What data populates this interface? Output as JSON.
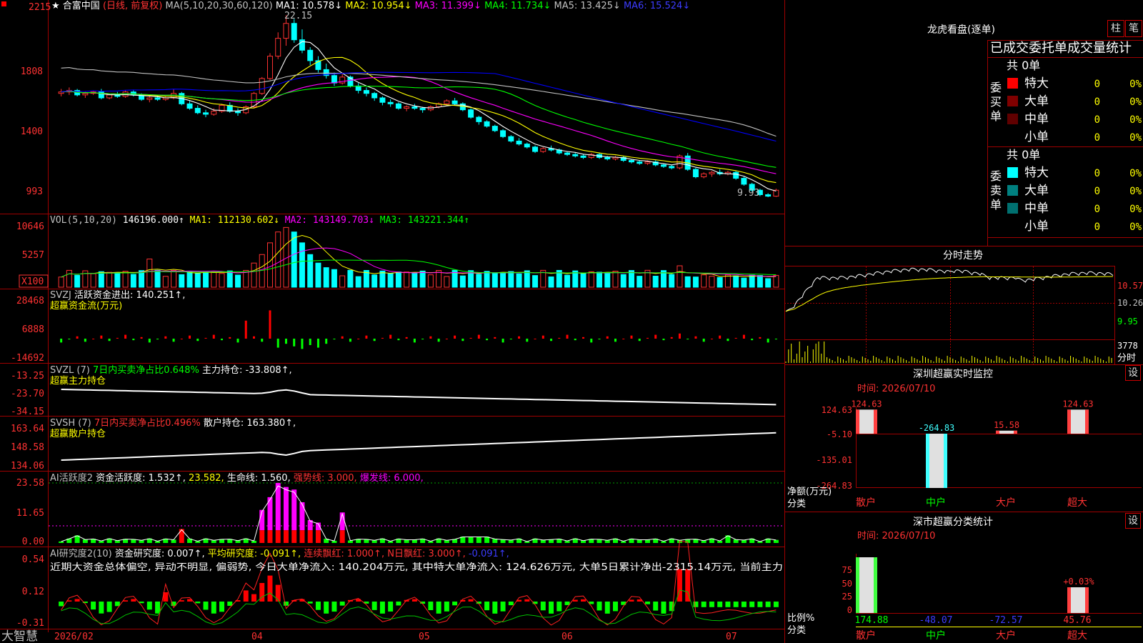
{
  "colors": {
    "up": "#ff3232",
    "down": "#00ffff",
    "ma1": "#ffffff",
    "ma2": "#ffff00",
    "ma3": "#ff00ff",
    "ma4": "#00ff00",
    "ma5": "#c0c0c0",
    "ma6": "#0000ff",
    "pos": "#ff0000",
    "neg": "#00ff00",
    "grid": "#a00000"
  },
  "header": {
    "marker": "★",
    "stock_name": "合富中国",
    "mode": "(日线, 前复权)",
    "ma_def": "MA(5,10,20,30,60,120)",
    "ma_items": [
      {
        "label": "MA1: 10.578↓",
        "color": "#ffffff"
      },
      {
        "label": "MA2: 10.954↓",
        "color": "#ffff00"
      },
      {
        "label": "MA3: 11.399↓",
        "color": "#ff00ff"
      },
      {
        "label": "MA4: 11.734↓",
        "color": "#00ff00"
      },
      {
        "label": "MA5: 13.425↓",
        "color": "#c0c0c0"
      },
      {
        "label": "MA6: 15.524↓",
        "color": "#3c3cff"
      }
    ]
  },
  "price_axis": [
    "2215",
    "1808",
    "1400",
    "993"
  ],
  "price_marks": {
    "high": "22.15",
    "low": "9.93"
  },
  "vol_panel": {
    "label": "VOL(5,10,20)",
    "value": "146196.000↑",
    "items": [
      {
        "label": "MA1: 112130.602↓",
        "color": "#ffff00"
      },
      {
        "label": "MA2: 143149.703↓",
        "color": "#ff00ff"
      },
      {
        "label": "MA3: 143221.344↑",
        "color": "#00ff00"
      }
    ],
    "axis": [
      "10646",
      "5257"
    ],
    "unit": "X100"
  },
  "svzj": {
    "label": "SVZJ",
    "desc": "活跃资金进出: 140.251↑,",
    "subtitle": "超赢资金流(万元)",
    "axis": [
      "28468",
      "6888",
      "-14692"
    ]
  },
  "svzl": {
    "label": "SVZL (7)",
    "desc1": "7日内买卖净占比0.648%",
    "desc2": "主力持仓: -33.808↑,",
    "subtitle": "超赢主力持仓",
    "axis": [
      "-13.25",
      "-23.70",
      "-34.15"
    ]
  },
  "svsh": {
    "label": "SVSH (7)",
    "desc1": "7日内买卖净占比0.496%",
    "desc2": "散户持仓: 163.380↑,",
    "subtitle": "超赢散户持仓",
    "axis": [
      "163.64",
      "148.58",
      "134.06"
    ]
  },
  "ai_act": {
    "label": "AI活跃度2",
    "desc": "资金活跃度: 1.532↑,",
    "v2": "23.582,",
    "life": "生命线: 1.560,",
    "strong": "强势线: 3.000,",
    "burst": "爆发线: 6.000,",
    "axis": [
      "23.58",
      "11.65",
      "0.00"
    ]
  },
  "ai_res": {
    "label": "AI研究度2(10)",
    "desc": "资金研究度: 0.007↑,",
    "avg": "平均研究度: -0.091↑,",
    "cont": "连续飘红: 1.000↑,",
    "n": "N日飘红: 3.000↑,",
    "last": "-0.091↑,",
    "note": "近期大资金总体偏空, 异动不明显, 偏弱势, 今日大单净流入: 140.204万元, 其中特大单净流入: 124.626万元, 大单5日累计净出-2315.14万元, 当前主力",
    "axis": [
      "0.54",
      "0.12",
      "-0.31"
    ]
  },
  "date_axis": {
    "start": "2026/02",
    "ticks": [
      "04",
      "05",
      "06",
      "07"
    ]
  },
  "brand": "大智慧",
  "dragon": {
    "title": "龙虎看盘(逐单)",
    "btn1": "柱",
    "btn2": "笔",
    "header": "已成交委托单成交量统计",
    "buy": {
      "side": "委买单",
      "total": "共 0单",
      "rows": [
        {
          "name": "特大",
          "v": "0",
          "p": "0%",
          "color": "#ff0000"
        },
        {
          "name": "大单",
          "v": "0",
          "p": "0%",
          "color": "#800000"
        },
        {
          "name": "中单",
          "v": "0",
          "p": "0%",
          "color": "#600000"
        },
        {
          "name": "小单",
          "v": "0",
          "p": "0%",
          "color": ""
        }
      ]
    },
    "sell": {
      "side": "委卖单",
      "total": "共 0单",
      "rows": [
        {
          "name": "特大",
          "v": "0",
          "p": "0%",
          "color": "#00ffff"
        },
        {
          "name": "大单",
          "v": "0",
          "p": "0%",
          "color": "#008080"
        },
        {
          "name": "中单",
          "v": "0",
          "p": "0%",
          "color": "#007070"
        },
        {
          "name": "小单",
          "v": "0",
          "p": "0%",
          "color": ""
        }
      ]
    }
  },
  "intraday": {
    "title": "分时走势",
    "axis": [
      "10.57",
      "10.26",
      "9.95"
    ],
    "vol_label": "3778",
    "vol_unit": "分时"
  },
  "monitor": {
    "title": "深圳超赢实时监控",
    "btn": "设",
    "date": "时间: 2026/07/10",
    "axis": [
      "124.63",
      "-5.10",
      "-135.01",
      "-264.83"
    ],
    "ylabel1": "净额(万元)",
    "ylabel2": "分类",
    "bars": [
      {
        "cat": "散户",
        "label": "124.63",
        "value": 124.63
      },
      {
        "cat": "中户",
        "label": "-264.83",
        "value": -264.83
      },
      {
        "cat": "大户",
        "label": "15.58",
        "value": 15.58
      },
      {
        "cat": "超大",
        "label": "124.63",
        "value": 124.63
      }
    ]
  },
  "classify": {
    "title": "深市超赢分类统计",
    "btn": "设",
    "date": "时间: 2026/07/10",
    "axis": [
      "75",
      "50",
      "25",
      "0"
    ],
    "ylabel1": "比例%",
    "ylabel2": "分类",
    "pct_label": "+0.03%",
    "bars": [
      {
        "cat": "散户",
        "label": "174.88",
        "value": 174.88
      },
      {
        "cat": "中户",
        "label": "-48.07",
        "value": -48.07
      },
      {
        "cat": "大户",
        "label": "-72.57",
        "value": -72.57
      },
      {
        "cat": "超大",
        "label": "45.76",
        "value": 45.76
      }
    ]
  },
  "chart_data": {
    "type": "candlestick",
    "title": "合富中国 (日线, 前复权)",
    "ylim": [
      9.5,
      22.5
    ],
    "ohlc": [
      [
        16.9,
        17.2,
        16.7,
        17.0
      ],
      [
        17.0,
        17.3,
        16.8,
        17.1
      ],
      [
        17.1,
        17.2,
        16.7,
        16.8
      ],
      [
        16.8,
        17.0,
        16.6,
        16.9
      ],
      [
        16.9,
        17.1,
        16.8,
        17.0
      ],
      [
        17.0,
        17.2,
        16.5,
        16.6
      ],
      [
        16.6,
        16.9,
        16.5,
        16.8
      ],
      [
        16.8,
        17.0,
        16.6,
        16.7
      ],
      [
        16.7,
        17.1,
        16.6,
        17.0
      ],
      [
        17.0,
        17.1,
        16.7,
        16.8
      ],
      [
        16.8,
        16.9,
        16.4,
        16.5
      ],
      [
        16.5,
        16.7,
        16.3,
        16.6
      ],
      [
        16.6,
        16.8,
        16.4,
        16.5
      ],
      [
        16.5,
        16.7,
        16.4,
        16.6
      ],
      [
        16.6,
        17.2,
        16.5,
        16.9
      ],
      [
        16.9,
        17.0,
        16.1,
        16.2
      ],
      [
        16.2,
        16.4,
        15.8,
        15.9
      ],
      [
        15.9,
        16.1,
        15.5,
        15.6
      ],
      [
        15.6,
        15.8,
        15.3,
        15.5
      ],
      [
        15.5,
        15.9,
        15.4,
        15.7
      ],
      [
        15.7,
        16.2,
        15.6,
        16.1
      ],
      [
        16.1,
        16.3,
        15.6,
        15.7
      ],
      [
        15.7,
        15.9,
        15.4,
        15.6
      ],
      [
        15.6,
        16.1,
        15.5,
        16.0
      ],
      [
        16.0,
        17.0,
        15.9,
        16.9
      ],
      [
        16.9,
        18.0,
        16.8,
        17.9
      ],
      [
        17.9,
        19.6,
        17.8,
        19.4
      ],
      [
        19.4,
        21.0,
        19.2,
        20.6
      ],
      [
        20.6,
        22.15,
        20.1,
        21.6
      ],
      [
        21.6,
        21.9,
        20.3,
        20.5
      ],
      [
        20.5,
        21.2,
        19.6,
        19.8
      ],
      [
        19.8,
        20.0,
        18.8,
        19.1
      ],
      [
        19.1,
        19.4,
        18.3,
        18.5
      ],
      [
        18.5,
        18.9,
        17.9,
        18.1
      ],
      [
        18.1,
        18.3,
        17.4,
        17.6
      ],
      [
        17.6,
        18.2,
        17.5,
        18.0
      ],
      [
        18.0,
        18.1,
        17.3,
        17.4
      ],
      [
        17.4,
        17.6,
        16.9,
        17.1
      ],
      [
        17.1,
        17.3,
        16.7,
        16.9
      ],
      [
        16.9,
        17.0,
        16.4,
        16.6
      ],
      [
        16.6,
        16.7,
        16.1,
        16.3
      ],
      [
        16.3,
        16.5,
        16.0,
        16.2
      ],
      [
        16.2,
        16.3,
        15.8,
        15.9
      ],
      [
        15.9,
        16.1,
        15.7,
        16.0
      ],
      [
        16.0,
        16.2,
        15.8,
        15.9
      ],
      [
        15.9,
        16.0,
        15.6,
        15.8
      ],
      [
        15.8,
        16.1,
        15.7,
        16.0
      ],
      [
        16.0,
        16.3,
        15.9,
        16.2
      ],
      [
        16.2,
        16.5,
        16.1,
        16.4
      ],
      [
        16.4,
        16.6,
        16.1,
        16.2
      ],
      [
        16.2,
        16.3,
        15.7,
        15.8
      ],
      [
        15.8,
        15.9,
        15.2,
        15.3
      ],
      [
        15.3,
        15.4,
        14.8,
        15.0
      ],
      [
        15.0,
        15.1,
        14.6,
        14.7
      ],
      [
        14.7,
        14.8,
        14.3,
        14.4
      ],
      [
        14.4,
        14.5,
        13.9,
        14.0
      ],
      [
        14.0,
        14.1,
        13.6,
        13.7
      ],
      [
        13.7,
        13.9,
        13.4,
        13.5
      ],
      [
        13.5,
        13.6,
        13.2,
        13.3
      ],
      [
        13.3,
        13.4,
        12.9,
        13.0
      ],
      [
        13.0,
        13.3,
        12.9,
        13.2
      ],
      [
        13.2,
        13.4,
        13.0,
        13.1
      ],
      [
        13.1,
        13.2,
        12.8,
        12.9
      ],
      [
        12.9,
        13.0,
        12.7,
        12.8
      ],
      [
        12.8,
        12.9,
        12.6,
        12.7
      ],
      [
        12.7,
        12.8,
        12.5,
        12.6
      ],
      [
        12.6,
        12.9,
        12.5,
        12.8
      ],
      [
        12.8,
        12.9,
        12.5,
        12.6
      ],
      [
        12.6,
        12.7,
        12.4,
        12.5
      ],
      [
        12.5,
        12.7,
        12.4,
        12.6
      ],
      [
        12.6,
        12.7,
        12.3,
        12.4
      ],
      [
        12.4,
        12.5,
        12.2,
        12.3
      ],
      [
        12.3,
        12.4,
        12.1,
        12.2
      ],
      [
        12.2,
        12.4,
        12.1,
        12.3
      ],
      [
        12.3,
        12.4,
        12.0,
        12.1
      ],
      [
        12.1,
        12.2,
        11.9,
        12.0
      ],
      [
        12.0,
        12.1,
        11.8,
        11.9
      ],
      [
        11.9,
        12.8,
        11.8,
        12.7
      ],
      [
        12.7,
        12.9,
        11.7,
        11.8
      ],
      [
        11.8,
        11.9,
        11.2,
        11.3
      ],
      [
        11.3,
        11.6,
        11.2,
        11.5
      ],
      [
        11.5,
        11.7,
        11.3,
        11.6
      ],
      [
        11.6,
        11.8,
        11.4,
        11.5
      ],
      [
        11.5,
        11.7,
        11.4,
        11.6
      ],
      [
        11.6,
        11.7,
        11.1,
        11.2
      ],
      [
        11.2,
        11.3,
        10.7,
        10.8
      ],
      [
        10.8,
        10.9,
        10.3,
        10.4
      ],
      [
        10.4,
        10.5,
        10.0,
        10.1
      ],
      [
        10.1,
        10.2,
        9.93,
        10.0
      ],
      [
        10.0,
        10.5,
        9.95,
        10.4
      ]
    ]
  }
}
